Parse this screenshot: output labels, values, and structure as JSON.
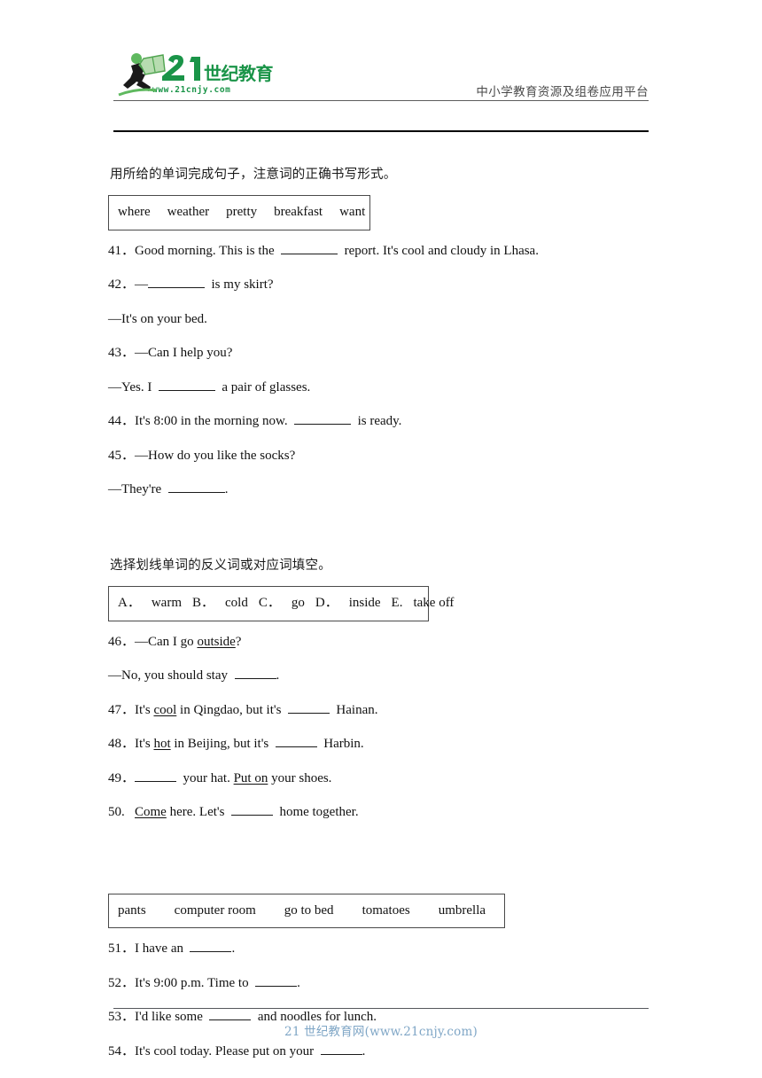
{
  "header": {
    "logo_text_main": "21世纪教育",
    "logo_text_url": "www.21cnjy.com",
    "tagline": "中小学教育资源及组卷应用平台",
    "brand_green": "#1a9448",
    "brand_dark": "#1a1a1a"
  },
  "sections": [
    {
      "prompt": "用所给的单词完成句子，注意词的正确书写形式。",
      "word_bank": [
        "where",
        "weather",
        "pretty",
        "breakfast",
        "want"
      ],
      "questions": [
        {
          "num": "41．",
          "pre": "Good morning. This is the",
          "blank": "long",
          "post": "report. It's cool and cloudy in Lhasa."
        },
        {
          "num": "42．",
          "pre": "—",
          "blank": "long",
          "post": "is my skirt?"
        },
        {
          "answer": "—It's on your bed."
        },
        {
          "num": "43．",
          "pre": "—Can I help you?"
        },
        {
          "answer_pre": "—Yes. I",
          "blank": "long",
          "answer_post": "a pair of glasses."
        },
        {
          "num": "44．",
          "pre": "It's 8:00 in the morning now.",
          "blank": "long",
          "post": "is ready."
        },
        {
          "num": "45．",
          "pre": "—How do you like the socks?"
        },
        {
          "answer_pre": "—They're",
          "blank": "long",
          "answer_post": "."
        }
      ]
    },
    {
      "prompt": "选择划线单词的反义词或对应词填空。",
      "word_bank": [
        "A．",
        "warm",
        "B．",
        "cold",
        "C．",
        "go",
        "D．",
        "inside",
        "E.",
        "take off"
      ],
      "questions": [
        {
          "num": "46．",
          "pre": "—Can I go ",
          "underline": "outside",
          "post": "?"
        },
        {
          "answer_pre": "—No, you should stay",
          "blank": "short",
          "answer_post": "."
        },
        {
          "num": "47．",
          "pre": "It's ",
          "underline": "cool",
          "mid": " in Qingdao, but it's",
          "blank": "short",
          "post": "Hainan."
        },
        {
          "num": "48．",
          "pre": "It's ",
          "underline": "hot",
          "mid": " in Beijing, but it's",
          "blank": "short",
          "post": "Harbin."
        },
        {
          "num": "49．",
          "blank": "short",
          "mid2": "your hat. ",
          "underline": "Put on",
          "post": " your shoes."
        },
        {
          "num": "50．",
          "underline": "Come",
          "mid3": " here. Let's",
          "blank": "short",
          "post": "home together."
        }
      ]
    },
    {
      "prompt": "",
      "word_bank": [
        "pants",
        "computer room",
        "go to bed",
        "tomatoes",
        "umbrella"
      ],
      "questions": [
        {
          "num": "51．",
          "pre": "I have an",
          "blank": "short",
          "post": "."
        },
        {
          "num": "52．",
          "pre": "It's 9:00 p.m. Time to",
          "blank": "short",
          "post": "."
        },
        {
          "num": "53．",
          "pre": "I'd like some",
          "blank": "short",
          "post": "and noodles for lunch."
        },
        {
          "num": "54．",
          "pre": "It's cool today. Please put on your",
          "blank": "short",
          "post": "."
        }
      ]
    }
  ],
  "footer": {
    "text": "21 世纪教育网(www.21cnjy.com)"
  },
  "s1": {
    "prompt": "用所给的单词完成句子，注意词的正确书写形式。",
    "w0": "where",
    "w1": "weather",
    "w2": "pretty",
    "w3": "breakfast",
    "w4": "want",
    "q41_num": "41．",
    "q41_a": "Good morning. This is the",
    "q41_b": "report. It's cool and cloudy in Lhasa.",
    "q42_num": "42．",
    "q42_a": "—",
    "q42_b": "is my skirt?",
    "q42_ans": "—It's on your bed.",
    "q43_num": "43．",
    "q43_a": "—Can I help you?",
    "q43_ans_a": "—Yes. I",
    "q43_ans_b": "a pair of glasses.",
    "q44_num": "44．",
    "q44_a": "It's 8:00 in the morning now.",
    "q44_b": "is ready.",
    "q45_num": "45．",
    "q45_a": "—How do you like the socks?",
    "q45_ans_a": "—They're",
    "q45_ans_b": "."
  },
  "s2": {
    "prompt": "选择划线单词的反义词或对应词填空。",
    "o0": "A．",
    "o1": "warm",
    "o2": "B．",
    "o3": "cold",
    "o4": "C．",
    "o5": "go",
    "o6": "D．",
    "o7": "inside",
    "o8": "E.",
    "o9": "take off",
    "q46_num": "46．",
    "q46_a": "—Can I go",
    "q46_u": "outside",
    "q46_b": "?",
    "q46_ans_a": "—No, you should stay",
    "q46_ans_b": ".",
    "q47_num": "47．",
    "q47_a": "It's",
    "q47_u": "cool",
    "q47_b": "in Qingdao, but it's",
    "q47_c": "Hainan.",
    "q48_num": "48．",
    "q48_a": "It's",
    "q48_u": "hot",
    "q48_b": "in Beijing, but it's",
    "q48_c": "Harbin.",
    "q49_num": "49．",
    "q49_a": "your hat.",
    "q49_u": "Put on",
    "q49_b": "your shoes.",
    "q50_num": "50.",
    "q50_u": "Come",
    "q50_a": "here. Let's",
    "q50_b": "home together."
  },
  "s3": {
    "w0": "pants",
    "w1": "computer room",
    "w2": "go to bed",
    "w3": "tomatoes",
    "w4": "umbrella",
    "q51_num": "51．",
    "q51_a": "I have an",
    "q51_b": ".",
    "q52_num": "52．",
    "q52_a": "It's 9:00 p.m. Time to",
    "q52_b": ".",
    "q53_num": "53．",
    "q53_a": "I'd like some",
    "q53_b": "and noodles for lunch.",
    "q54_num": "54．",
    "q54_a": "It's cool today. Please put on your",
    "q54_b": "."
  }
}
